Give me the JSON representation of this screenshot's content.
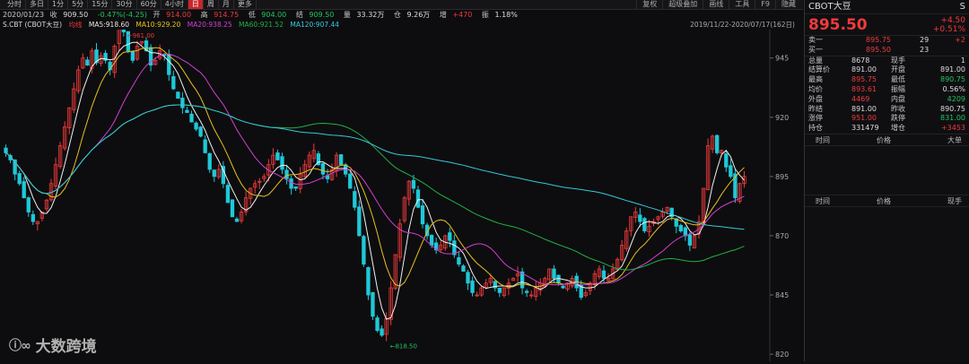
{
  "toolbar": {
    "periods": [
      "分时",
      "多日",
      "1分",
      "5分",
      "15分",
      "30分",
      "60分",
      "4小时",
      "日",
      "周",
      "月",
      "更多"
    ],
    "active_index": 8,
    "tools": [
      "复权",
      "超级叠加",
      "画线",
      "工具",
      "F9",
      "隐藏"
    ]
  },
  "info": {
    "date": "2020/01/23",
    "close_label": "收",
    "close": "909.50",
    "change": "-0.47%(-4.25)",
    "open_label": "开",
    "open": "914.00",
    "high_label": "高",
    "high": "914.75",
    "low_label": "低",
    "low": "904.00",
    "settle_label": "结",
    "settle": "909.50",
    "vol_label": "量",
    "vol": "33.32万",
    "oi_label": "仓",
    "oi": "9.26万",
    "oi_chg_label": "增",
    "oi_chg": "+470",
    "amp_label": "振",
    "amp": "1.18%"
  },
  "ma": {
    "symbol": "S.CBT (CBOT大豆)",
    "tag": "均线",
    "ma5": "MA5:918.60",
    "ma10": "MA10:929.20",
    "ma20": "MA20:938.25",
    "ma60": "MA60:921.52",
    "ma120": "MA120:907.44",
    "range": "2019/11/22-2020/07/17(162日)"
  },
  "chart_data": {
    "type": "candlestick",
    "y_ticks": [
      "945",
      "920",
      "895",
      "870",
      "845",
      "820"
    ],
    "y_range": [
      817,
      957
    ],
    "max_label": "961.00",
    "min_label": "818.50",
    "colors": {
      "up": "#f03a3a",
      "down": "#1fc8d8",
      "ma5": "#f0f0f0",
      "ma10": "#e8c020",
      "ma20": "#d040d0",
      "ma60": "#22b043",
      "ma120": "#38c8d8"
    },
    "closes": [
      905,
      902,
      896,
      892,
      886,
      880,
      876,
      876,
      880,
      885,
      892,
      900,
      908,
      916,
      924,
      932,
      940,
      945,
      942,
      948,
      943,
      946,
      944,
      940,
      950,
      960,
      956,
      948,
      944,
      950,
      952,
      948,
      942,
      944,
      948,
      946,
      938,
      932,
      928,
      924,
      922,
      918,
      915,
      912,
      905,
      898,
      895,
      898,
      892,
      884,
      878,
      876,
      880,
      886,
      890,
      892,
      893,
      895,
      900,
      904,
      902,
      898,
      894,
      890,
      890,
      896,
      900,
      904,
      906,
      900,
      896,
      894,
      898,
      904,
      900,
      896,
      890,
      882,
      870,
      858,
      845,
      836,
      830,
      828,
      835,
      848,
      862,
      875,
      886,
      893,
      890,
      882,
      875,
      870,
      866,
      864,
      866,
      870,
      868,
      862,
      858,
      855,
      850,
      846,
      845,
      848,
      850,
      852,
      848,
      846,
      848,
      850,
      852,
      854,
      848,
      846,
      845,
      848,
      850,
      852,
      856,
      852,
      850,
      848,
      850,
      852,
      848,
      844,
      846,
      850,
      854,
      856,
      852,
      852,
      856,
      860,
      866,
      872,
      878,
      880,
      876,
      872,
      874,
      876,
      878,
      880,
      882,
      878,
      874,
      872,
      870,
      866,
      870,
      876,
      890,
      908,
      912,
      905,
      906,
      899,
      895,
      886,
      892,
      895
    ]
  },
  "panel": {
    "title": "CBOT大豆",
    "flag": "S",
    "price": "895.50",
    "change": "+4.50",
    "change_pct": "+0.51%",
    "ask_label": "卖一",
    "ask": "895.75",
    "ask_vol": "29",
    "ask_chg": "+2",
    "bid_label": "买一",
    "bid": "895.50",
    "bid_vol": "23",
    "stats": [
      {
        "k1": "总量",
        "v1": "8678",
        "k2": "现手",
        "v2": "1",
        "c1": "white",
        "c2": "white"
      },
      {
        "k1": "结算价",
        "v1": "891.00",
        "k2": "开盘",
        "v2": "891.00",
        "c1": "white",
        "c2": "white"
      },
      {
        "k1": "最高",
        "v1": "895.75",
        "k2": "最低",
        "v2": "890.75",
        "c1": "red",
        "c2": "green"
      },
      {
        "k1": "均价",
        "v1": "893.61",
        "k2": "振幅",
        "v2": "0.56%",
        "c1": "red",
        "c2": "white"
      },
      {
        "k1": "外盘",
        "v1": "4469",
        "k2": "内盘",
        "v2": "4209",
        "c1": "red",
        "c2": "green"
      },
      {
        "k1": "昨结",
        "v1": "891.00",
        "k2": "昨收",
        "v2": "890.75",
        "c1": "white",
        "c2": "white"
      },
      {
        "k1": "涨停",
        "v1": "951.00",
        "k2": "跌停",
        "v2": "831.00",
        "c1": "red",
        "c2": "green"
      },
      {
        "k1": "持仓",
        "v1": "331479",
        "k2": "增仓",
        "v2": "+3453",
        "c1": "white",
        "c2": "red"
      }
    ],
    "hdr1": [
      "时间",
      "价格",
      "大单"
    ],
    "hdr2": [
      "时间",
      "价格",
      "现手"
    ]
  },
  "watermark": {
    "text": "大数跨境"
  }
}
